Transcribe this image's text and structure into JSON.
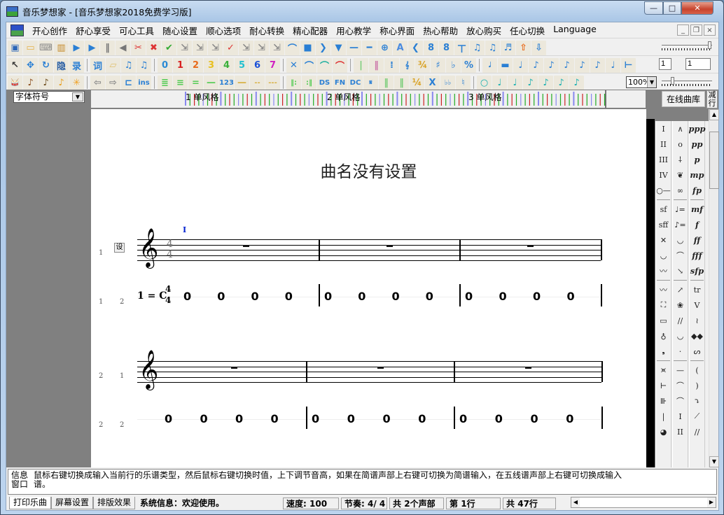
{
  "window": {
    "title": "音乐梦想家 - [音乐梦想家2018免费学习版]",
    "controls": {
      "minimize": "—",
      "maximize": "□",
      "close": "✕"
    }
  },
  "menu": {
    "items": [
      "开心创作",
      "舒心享受",
      "可心工具",
      "随心设置",
      "顺心选项",
      "耐心转换",
      "精心配器",
      "用心教学",
      "称心界面",
      "热心帮助",
      "放心购买",
      "任心切换",
      "Language"
    ],
    "mdi": {
      "minimize": "_",
      "restore": "❐",
      "close": "×"
    }
  },
  "toolbar1": {
    "icons": [
      {
        "name": "save-icon",
        "glyph": "▣",
        "color": "#2b66b8"
      },
      {
        "name": "open-folder-icon",
        "glyph": "▭",
        "color": "#e4b24a"
      },
      {
        "name": "keyboard-icon",
        "glyph": "⌨",
        "color": "#888"
      },
      {
        "name": "piano-icon",
        "glyph": "▥",
        "color": "#c58a2a"
      },
      {
        "name": "play-icon",
        "glyph": "▶",
        "color": "#2a7fd4"
      },
      {
        "name": "play-from-cursor-icon",
        "glyph": "▶",
        "color": "#2a7fd4"
      },
      {
        "name": "pause-icon",
        "glyph": "‖",
        "color": "#777"
      },
      {
        "name": "stop-icon",
        "glyph": "◀",
        "color": "#777"
      },
      {
        "name": "delete-note-icon",
        "glyph": "✂",
        "color": "#d33"
      },
      {
        "name": "delete-measure-icon",
        "glyph": "✖",
        "color": "#d33"
      },
      {
        "name": "check-icon",
        "glyph": "✔",
        "color": "#3a3"
      },
      {
        "name": "marker-1-icon",
        "glyph": "⇲",
        "color": "#888"
      },
      {
        "name": "marker-2-icon",
        "glyph": "⇲",
        "color": "#888"
      },
      {
        "name": "marker-3-icon",
        "glyph": "⇲",
        "color": "#888"
      },
      {
        "name": "spellcheck-icon",
        "glyph": "✓",
        "color": "#d33"
      },
      {
        "name": "marker-4-icon",
        "glyph": "⇲",
        "color": "#888"
      },
      {
        "name": "marker-5-icon",
        "glyph": "⇲",
        "color": "#888"
      },
      {
        "name": "marker-6-icon",
        "glyph": "⇲",
        "color": "#888"
      },
      {
        "name": "fermata-icon",
        "glyph": "⌒",
        "color": "#2a7fd4"
      },
      {
        "name": "square-icon",
        "glyph": "■",
        "color": "#2a7fd4"
      },
      {
        "name": "chevron-right-icon",
        "glyph": "❯",
        "color": "#2a7fd4"
      },
      {
        "name": "triangle-down-icon",
        "glyph": "▼",
        "color": "#2a7fd4"
      },
      {
        "name": "line-short-icon",
        "glyph": "—",
        "color": "#2a7fd4"
      },
      {
        "name": "line-long-icon",
        "glyph": "━",
        "color": "#2a7fd4"
      },
      {
        "name": "crosshair-icon",
        "glyph": "⊕",
        "color": "#2a7fd4"
      },
      {
        "name": "text-a-icon",
        "glyph": "A",
        "color": "#4a8be0"
      },
      {
        "name": "decrescendo-icon",
        "glyph": "❮",
        "color": "#2a7fd4"
      },
      {
        "name": "add-voice-icon",
        "glyph": "8",
        "color": "#2a7fd4"
      },
      {
        "name": "remove-voice-icon",
        "glyph": "8",
        "color": "#2a7fd4"
      },
      {
        "name": "tuplet-icon",
        "glyph": "ㄒ",
        "color": "#2a7fd4"
      },
      {
        "name": "beam-1-icon",
        "glyph": "♫",
        "color": "#2a7fd4"
      },
      {
        "name": "beam-2-icon",
        "glyph": "♫",
        "color": "#2a7fd4"
      },
      {
        "name": "beam-3-icon",
        "glyph": "♬",
        "color": "#2a7fd4"
      },
      {
        "name": "upload-icon",
        "glyph": "⇧",
        "color": "#e86a1a"
      },
      {
        "name": "download-icon",
        "glyph": "⇩",
        "color": "#2a7fd4"
      }
    ]
  },
  "toolbar2": {
    "icons": [
      {
        "name": "pointer-icon",
        "glyph": "↖",
        "color": "#333"
      },
      {
        "name": "move-icon",
        "glyph": "✥",
        "color": "#2a7fd4"
      },
      {
        "name": "replace-icon",
        "glyph": "↻",
        "color": "#2a7fd4"
      },
      {
        "name": "hide-icon",
        "glyph": "隐",
        "color": "#2a5fa4"
      },
      {
        "name": "record-icon",
        "glyph": "录",
        "color": "#2a7fd4"
      },
      {
        "name": "sep"
      },
      {
        "name": "lyrics-icon",
        "glyph": "词",
        "color": "#2a7fd4"
      },
      {
        "name": "eraser-icon",
        "glyph": "▱",
        "color": "#e0c070"
      },
      {
        "name": "beam-join-icon",
        "glyph": "♫",
        "color": "#2a7fd4"
      },
      {
        "name": "beam-split-icon",
        "glyph": "♫",
        "color": "#2a7fd4"
      },
      {
        "name": "sep"
      },
      {
        "name": "digit-0-icon",
        "glyph": "0",
        "color": "#2a8ad4"
      },
      {
        "name": "digit-1-icon",
        "glyph": "1",
        "color": "#d82020"
      },
      {
        "name": "digit-2-icon",
        "glyph": "2",
        "color": "#e86a1a"
      },
      {
        "name": "digit-3-icon",
        "glyph": "3",
        "color": "#e8c020"
      },
      {
        "name": "digit-4-icon",
        "glyph": "4",
        "color": "#3ab03a"
      },
      {
        "name": "digit-5-icon",
        "glyph": "5",
        "color": "#20c0d0"
      },
      {
        "name": "digit-6-icon",
        "glyph": "6",
        "color": "#1a50d8"
      },
      {
        "name": "digit-7-icon",
        "glyph": "7",
        "color": "#d020c0"
      },
      {
        "name": "sep"
      },
      {
        "name": "cross-icon",
        "glyph": "✕",
        "color": "#2a7fd4"
      },
      {
        "name": "slur-icon",
        "glyph": "⌒",
        "color": "#2a7fd4"
      },
      {
        "name": "tie-icon",
        "glyph": "⌒",
        "color": "#20b0a0"
      },
      {
        "name": "accent-slur-icon",
        "glyph": "⌒",
        "color": "#d33"
      },
      {
        "name": "sep"
      },
      {
        "name": "barline-single-icon",
        "glyph": "|",
        "color": "#7c7"
      },
      {
        "name": "barline-double-icon",
        "glyph": "‖",
        "color": "#c7a"
      },
      {
        "name": "repeat-icon",
        "glyph": "⁞",
        "color": "#2a7fd4"
      },
      {
        "name": "treble-clef-icon",
        "glyph": "𝄞",
        "color": "#2a7fd4"
      },
      {
        "name": "time-sig-34-icon",
        "glyph": "¾",
        "color": "#d8a020"
      },
      {
        "name": "sharp-icon",
        "glyph": "♯",
        "color": "#2a7fd4"
      },
      {
        "name": "flat-icon",
        "glyph": "♭",
        "color": "#2a7fd4"
      },
      {
        "name": "percent-icon",
        "glyph": "%",
        "color": "#2a7fd4"
      },
      {
        "name": "sep"
      },
      {
        "name": "half-note-icon",
        "glyph": "𝅗𝅥",
        "color": "#2a7fd4"
      },
      {
        "name": "whole-rest-icon",
        "glyph": "▬",
        "color": "#2a7fd4"
      },
      {
        "name": "quarter-note-icon",
        "glyph": "♩",
        "color": "#2a7fd4"
      },
      {
        "name": "eighth-note-icon",
        "glyph": "♪",
        "color": "#2a7fd4"
      },
      {
        "name": "sixteenth-note-icon",
        "glyph": "♪",
        "color": "#2a7fd4"
      },
      {
        "name": "x-note-icon",
        "glyph": "♪",
        "color": "#2a7fd4"
      },
      {
        "name": "ghost-note-icon",
        "glyph": "♪",
        "color": "#2a7fd4"
      },
      {
        "name": "grace-note-icon",
        "glyph": "♪",
        "color": "#2a7fd4"
      },
      {
        "name": "dotted-note-icon",
        "glyph": "♩",
        "color": "#2a7fd4"
      },
      {
        "name": "span-icon",
        "glyph": "⊢",
        "color": "#2a7fd4"
      }
    ],
    "input1": "1",
    "input2": "1"
  },
  "toolbar3": {
    "icons": [
      {
        "name": "drum-icon",
        "glyph": "🥁",
        "color": "#a33"
      },
      {
        "name": "violin-icon",
        "glyph": "♪",
        "color": "#8a4a1a"
      },
      {
        "name": "banjo-icon",
        "glyph": "♪",
        "color": "#6a4a1a"
      },
      {
        "name": "saxophone-icon",
        "glyph": "♪",
        "color": "#e8a020"
      },
      {
        "name": "asterisk-icon",
        "glyph": "✳",
        "color": "#f0a020"
      },
      {
        "name": "sep"
      },
      {
        "name": "arrow-left-icon",
        "glyph": "⇦",
        "color": "#888"
      },
      {
        "name": "arrow-right-icon",
        "glyph": "⇨",
        "color": "#888"
      },
      {
        "name": "bracket-icon",
        "glyph": "⊏",
        "color": "#2a7fd4"
      },
      {
        "name": "insert-icon",
        "glyph": "ins",
        "color": "#2a7fd4"
      },
      {
        "name": "sep"
      },
      {
        "name": "lines-4-icon",
        "glyph": "≣",
        "color": "#5c5"
      },
      {
        "name": "lines-3-icon",
        "glyph": "≡",
        "color": "#5c5"
      },
      {
        "name": "lines-2-icon",
        "glyph": "=",
        "color": "#5c5"
      },
      {
        "name": "lines-1-icon",
        "glyph": "—",
        "color": "#5c5"
      },
      {
        "name": "number-123-icon",
        "glyph": "123",
        "color": "#2a7fd4"
      },
      {
        "name": "dash-1-icon",
        "glyph": "—",
        "color": "#d8b040"
      },
      {
        "name": "dash-2-icon",
        "glyph": "--",
        "color": "#d8b040"
      },
      {
        "name": "dash-3-icon",
        "glyph": "---",
        "color": "#d8b040"
      },
      {
        "name": "sep"
      },
      {
        "name": "repeat-start-icon",
        "glyph": "‖:",
        "color": "#5c5"
      },
      {
        "name": "repeat-end-icon",
        "glyph": ":‖",
        "color": "#5c5"
      },
      {
        "name": "ds-icon",
        "glyph": "DS",
        "color": "#2a7fd4"
      },
      {
        "name": "fine-icon",
        "glyph": "FN",
        "color": "#2a7fd4"
      },
      {
        "name": "dc-icon",
        "glyph": "DC",
        "color": "#2a7fd4"
      },
      {
        "name": "segno-icon",
        "glyph": "𝄋",
        "color": "#2a7fd4"
      },
      {
        "name": "bar-green-1-icon",
        "glyph": "‖",
        "color": "#7c7"
      },
      {
        "name": "bar-green-2-icon",
        "glyph": "‖",
        "color": "#7c7"
      },
      {
        "name": "time-sig-44-icon",
        "glyph": "¼",
        "color": "#d8a020"
      },
      {
        "name": "double-sharp-icon",
        "glyph": "X",
        "color": "#2a7fd4"
      },
      {
        "name": "double-flat-icon",
        "glyph": "♭♭",
        "color": "#2a7fd4"
      },
      {
        "name": "natural-icon",
        "glyph": "♮",
        "color": "#2a7fd4"
      },
      {
        "name": "sep"
      },
      {
        "name": "whole-note-icon",
        "glyph": "○",
        "color": "#1ab0b0"
      },
      {
        "name": "half-note-teal-icon",
        "glyph": "♩",
        "color": "#1ab0b0"
      },
      {
        "name": "quarter-note-teal-icon",
        "glyph": "♩",
        "color": "#1ab0b0"
      },
      {
        "name": "eighth-note-teal-icon",
        "glyph": "♪",
        "color": "#1ab0b0"
      },
      {
        "name": "sixteenth-note-teal-icon",
        "glyph": "♪",
        "color": "#1ab0b0"
      },
      {
        "name": "thirtysecond-note-teal-icon",
        "glyph": "♪",
        "color": "#1ab0b0"
      },
      {
        "name": "sixtyfourth-note-teal-icon",
        "glyph": "♪",
        "color": "#1ab0b0"
      }
    ],
    "zoom": "100%"
  },
  "workarea": {
    "font_select": "字体符号",
    "ruler_labels": [
      "1 单风格",
      "2 单风格",
      "3 单风格"
    ],
    "online_library_button": "在线曲库",
    "reduce_rows_button": "减行"
  },
  "score": {
    "title": "曲名没有设置",
    "set_button": "设",
    "cursor_mark": "I",
    "key_signature": "1 = C",
    "time_signature": {
      "top": "4",
      "bottom": "4"
    },
    "systems": [
      {
        "staff": {
          "row": "1",
          "voice": "1",
          "measures": 3
        },
        "jianpu": {
          "row": "1",
          "voice": "2",
          "measures": [
            [
              "0",
              "0",
              "0",
              "0"
            ],
            [
              "0",
              "0",
              "0",
              "0"
            ],
            [
              "0",
              "0",
              "0",
              "0"
            ]
          ]
        }
      },
      {
        "staff": {
          "row": "2",
          "voice": "1",
          "measures": 3
        },
        "jianpu": {
          "row": "2",
          "voice": "2",
          "measures": [
            [
              "0",
              "0",
              "0",
              "0"
            ],
            [
              "0",
              "0",
              "0",
              "0"
            ],
            [
              "0",
              "0",
              "0",
              "0"
            ]
          ]
        }
      }
    ]
  },
  "symbols": {
    "col1": [
      "I",
      "II",
      "III",
      "IV",
      "○—",
      "sf",
      "sff",
      "✕",
      "◡",
      "〰",
      "〰",
      "⛶",
      "▭",
      "♁",
      "❟",
      "⪤",
      "⊢",
      "⊪",
      "|",
      "◕"
    ],
    "col2": [
      "∧",
      "o",
      "⸸",
      "❦",
      "∞",
      "♩=",
      "♪=",
      "◡",
      "⌒",
      "↘",
      "↗",
      "❀",
      "//",
      "◡",
      "·",
      "—",
      "⌒",
      "⌒",
      "I",
      "II"
    ],
    "col3": [
      "ppp",
      "pp",
      "p",
      "mp",
      "fp",
      "mf",
      "f",
      "ff",
      "fff",
      "sfp",
      "tr",
      "V",
      "≀",
      "◆◆",
      "ᔕ",
      "(",
      ")",
      "⤵",
      "⟋",
      "//"
    ]
  },
  "info": {
    "label": "信息窗口",
    "text": "鼠标右键切换成输入当前行的乐谱类型，然后鼠标右键切换时值，上下调节音高，如果在简谱声部上右键可切换为简谱输入，在五线谱声部上右键可切换成输入",
    "text2": "谱。"
  },
  "status": {
    "tabs": [
      "打印乐曲",
      "屏幕设置",
      "排版效果"
    ],
    "system_info": "系统信息：欢迎使用。",
    "tempo": "速度: 100",
    "meter": "节奏: 4/ 4",
    "voices": "共 2个声部",
    "current_row": "第 1行",
    "total_rows": "共 47行"
  }
}
